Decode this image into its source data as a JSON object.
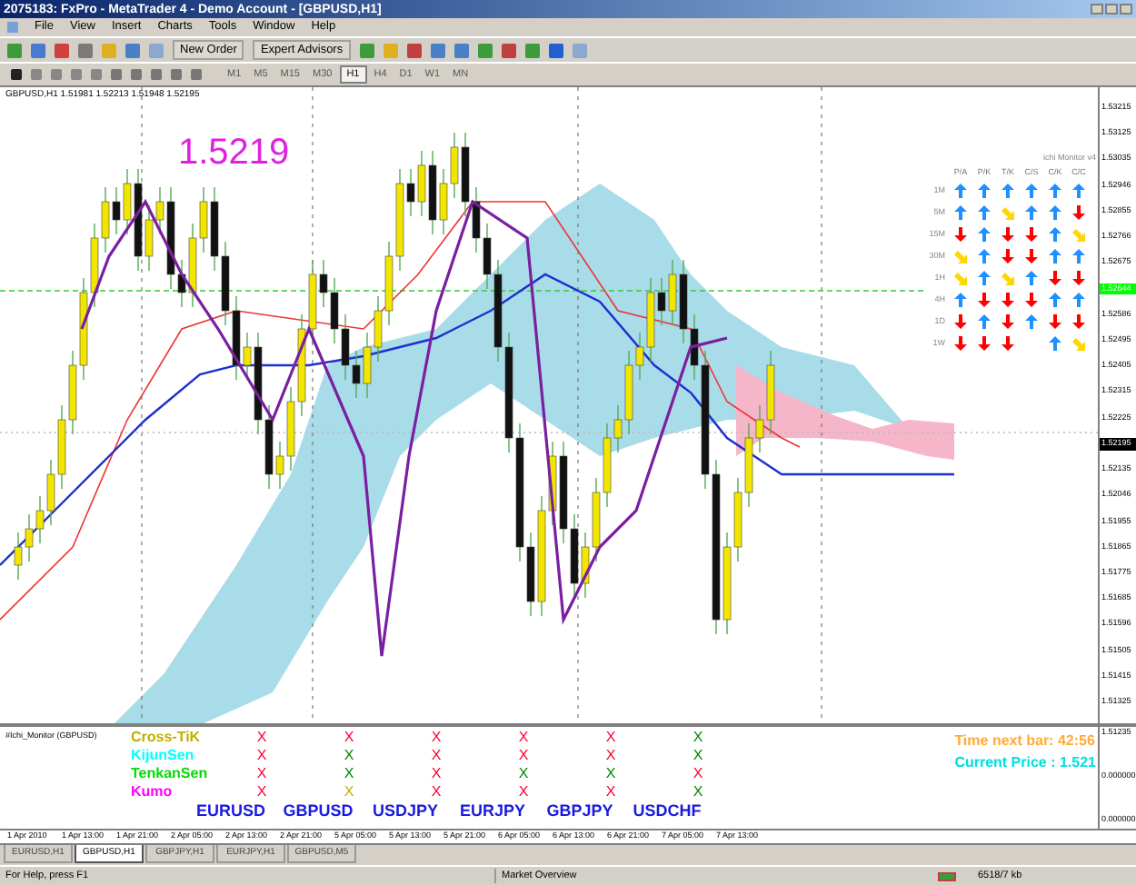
{
  "window": {
    "title": "2075183: FxPro - MetaTrader 4 - Demo Account - [GBPUSD,H1]"
  },
  "menu": [
    "File",
    "View",
    "Insert",
    "Charts",
    "Tools",
    "Window",
    "Help"
  ],
  "toolbar": {
    "buttons": [
      "New Order",
      "Expert Advisors"
    ]
  },
  "timeframes": [
    {
      "label": "M1",
      "selected": false
    },
    {
      "label": "M5",
      "selected": false
    },
    {
      "label": "M15",
      "selected": false
    },
    {
      "label": "M30",
      "selected": false
    },
    {
      "label": "H1",
      "selected": true
    },
    {
      "label": "H4",
      "selected": false
    },
    {
      "label": "D1",
      "selected": false
    },
    {
      "label": "W1",
      "selected": false
    },
    {
      "label": "MN",
      "selected": false
    }
  ],
  "chart": {
    "header": "GBPUSD,H1  1.51981 1.52213 1.51948 1.52195",
    "price_label": "1.5219",
    "price_axis": [
      {
        "label": "1.53215",
        "kind": "tick"
      },
      {
        "label": "1.53125",
        "kind": "tick"
      },
      {
        "label": "1.53035",
        "kind": "tick"
      },
      {
        "label": "1.52946",
        "kind": "tick"
      },
      {
        "label": "1.52855",
        "kind": "tick"
      },
      {
        "label": "1.52766",
        "kind": "tick"
      },
      {
        "label": "1.52675",
        "kind": "tick"
      },
      {
        "label": "1.52644",
        "kind": "marker",
        "color": "#00ff00"
      },
      {
        "label": "1.52586",
        "kind": "tick"
      },
      {
        "label": "1.52495",
        "kind": "tick"
      },
      {
        "label": "1.52405",
        "kind": "tick"
      },
      {
        "label": "1.52315",
        "kind": "tick"
      },
      {
        "label": "1.52225",
        "kind": "tick"
      },
      {
        "label": "1.52195",
        "kind": "marker",
        "color": "#000000"
      },
      {
        "label": "1.52135",
        "kind": "tick"
      },
      {
        "label": "1.52046",
        "kind": "tick"
      },
      {
        "label": "1.51955",
        "kind": "tick"
      },
      {
        "label": "1.51865",
        "kind": "tick"
      },
      {
        "label": "1.51775",
        "kind": "tick"
      },
      {
        "label": "1.51685",
        "kind": "tick"
      },
      {
        "label": "1.51596",
        "kind": "tick"
      },
      {
        "label": "1.51505",
        "kind": "tick"
      },
      {
        "label": "1.51415",
        "kind": "tick"
      },
      {
        "label": "1.51325",
        "kind": "tick"
      }
    ]
  },
  "monitor": {
    "title": "ichi Monitor v4",
    "columns": [
      "P/A",
      "P/K",
      "T/K",
      "C/S",
      "C/K",
      "C/C"
    ],
    "rows": [
      {
        "label": "1M",
        "cells": [
          {
            "kind": "up",
            "color": "#1e90ff"
          },
          {
            "kind": "up",
            "color": "#1e90ff"
          },
          {
            "kind": "up",
            "color": "#1e90ff"
          },
          {
            "kind": "up",
            "color": "#1e90ff"
          },
          {
            "kind": "up",
            "color": "#1e90ff"
          },
          {
            "kind": "up",
            "color": "#1e90ff"
          }
        ]
      },
      {
        "label": "5M",
        "cells": [
          {
            "kind": "up",
            "color": "#1e90ff"
          },
          {
            "kind": "up",
            "color": "#1e90ff"
          },
          {
            "kind": "side",
            "color": "#ffd700"
          },
          {
            "kind": "up",
            "color": "#1e90ff"
          },
          {
            "kind": "up",
            "color": "#1e90ff"
          },
          {
            "kind": "down",
            "color": "#ff0000"
          }
        ]
      },
      {
        "label": "15M",
        "cells": [
          {
            "kind": "down",
            "color": "#ff0000"
          },
          {
            "kind": "up",
            "color": "#1e90ff"
          },
          {
            "kind": "down",
            "color": "#ff0000"
          },
          {
            "kind": "down",
            "color": "#ff0000"
          },
          {
            "kind": "up",
            "color": "#1e90ff"
          },
          {
            "kind": "side",
            "color": "#ffd700"
          }
        ]
      },
      {
        "label": "30M",
        "cells": [
          {
            "kind": "side",
            "color": "#ffd700"
          },
          {
            "kind": "up",
            "color": "#1e90ff"
          },
          {
            "kind": "down",
            "color": "#ff0000"
          },
          {
            "kind": "down",
            "color": "#ff0000"
          },
          {
            "kind": "up",
            "color": "#1e90ff"
          },
          {
            "kind": "up",
            "color": "#1e90ff"
          }
        ]
      },
      {
        "label": "1H",
        "cells": [
          {
            "kind": "side",
            "color": "#ffd700"
          },
          {
            "kind": "up",
            "color": "#1e90ff"
          },
          {
            "kind": "side",
            "color": "#ffd700"
          },
          {
            "kind": "up",
            "color": "#1e90ff"
          },
          {
            "kind": "down",
            "color": "#ff0000"
          },
          {
            "kind": "down",
            "color": "#ff0000"
          }
        ]
      },
      {
        "label": "4H",
        "cells": [
          {
            "kind": "up",
            "color": "#1e90ff"
          },
          {
            "kind": "down",
            "color": "#ff0000"
          },
          {
            "kind": "down",
            "color": "#ff0000"
          },
          {
            "kind": "down",
            "color": "#ff0000"
          },
          {
            "kind": "up",
            "color": "#1e90ff"
          },
          {
            "kind": "up",
            "color": "#1e90ff"
          }
        ]
      },
      {
        "label": "1D",
        "cells": [
          {
            "kind": "down",
            "color": "#ff0000"
          },
          {
            "kind": "up",
            "color": "#1e90ff"
          },
          {
            "kind": "down",
            "color": "#ff0000"
          },
          {
            "kind": "up",
            "color": "#1e90ff"
          },
          {
            "kind": "down",
            "color": "#ff0000"
          },
          {
            "kind": "down",
            "color": "#ff0000"
          }
        ]
      },
      {
        "label": "1W",
        "cells": [
          {
            "kind": "down",
            "color": "#ff0000"
          },
          {
            "kind": "down",
            "color": "#ff0000"
          },
          {
            "kind": "down",
            "color": "#ff0000"
          },
          {
            "kind": "none"
          },
          {
            "kind": "up",
            "color": "#1e90ff"
          },
          {
            "kind": "side",
            "color": "#ffd700"
          }
        ]
      }
    ]
  },
  "indicator": {
    "title": "#Ichi_Monitor (GBPUSD)",
    "signals": [
      {
        "label": "Cross-TiK",
        "color": "#c0b000"
      },
      {
        "label": "KijunSen",
        "color": "#00ffff"
      },
      {
        "label": "TenkanSen",
        "color": "#00dd00"
      },
      {
        "label": "Kumo",
        "color": "#ff00ff"
      }
    ],
    "pairs": [
      {
        "name": "EURUSD",
        "marks": [
          {
            "text": "X",
            "color": "#ff0033"
          },
          {
            "text": "X",
            "color": "#ff0033"
          },
          {
            "text": "X",
            "color": "#ff0033"
          },
          {
            "text": "X",
            "color": "#ff0033"
          }
        ]
      },
      {
        "name": "GBPUSD",
        "marks": [
          {
            "text": "X",
            "color": "#ff0033"
          },
          {
            "text": "X",
            "color": "#008800"
          },
          {
            "text": "X",
            "color": "#008800"
          },
          {
            "text": "X",
            "color": "#c0b000"
          }
        ]
      },
      {
        "name": "USDJPY",
        "marks": [
          {
            "text": "X",
            "color": "#ff0033"
          },
          {
            "text": "X",
            "color": "#ff0033"
          },
          {
            "text": "X",
            "color": "#ff0033"
          },
          {
            "text": "X",
            "color": "#ff0033"
          }
        ]
      },
      {
        "name": "EURJPY",
        "marks": [
          {
            "text": "X",
            "color": "#ff0033"
          },
          {
            "text": "X",
            "color": "#ff0033"
          },
          {
            "text": "X",
            "color": "#008800"
          },
          {
            "text": "X",
            "color": "#ff0033"
          }
        ]
      },
      {
        "name": "GBPJPY",
        "marks": [
          {
            "text": "X",
            "color": "#ff0033"
          },
          {
            "text": "X",
            "color": "#ff0033"
          },
          {
            "text": "X",
            "color": "#008800"
          },
          {
            "text": "X",
            "color": "#ff0033"
          }
        ]
      },
      {
        "name": "USDCHF",
        "marks": [
          {
            "text": "X",
            "color": "#008800"
          },
          {
            "text": "X",
            "color": "#008800"
          },
          {
            "text": "X",
            "color": "#ff0033"
          },
          {
            "text": "X",
            "color": "#008800"
          }
        ]
      }
    ],
    "time_next_bar": "Time next bar:  42:56",
    "current_price": "Current Price :  1.521",
    "axis": [
      "1.51235",
      "0.000000",
      "0.000000"
    ]
  },
  "time_axis": [
    "1 Apr 2010",
    "1 Apr 13:00",
    "1 Apr 21:00",
    "2 Apr 05:00",
    "2 Apr 13:00",
    "2 Apr 21:00",
    "5 Apr 05:00",
    "5 Apr 13:00",
    "5 Apr 21:00",
    "6 Apr 05:00",
    "6 Apr 13:00",
    "6 Apr 21:00",
    "7 Apr 05:00",
    "7 Apr 13:00"
  ],
  "tabs": [
    {
      "label": "EURUSD,H1",
      "selected": false
    },
    {
      "label": "GBPUSD,H1",
      "selected": true
    },
    {
      "label": "GBPJPY,H1",
      "selected": false
    },
    {
      "label": "EURJPY,H1",
      "selected": false
    },
    {
      "label": "GBPUSD,M5",
      "selected": false
    }
  ],
  "status_bar": {
    "help": "For Help, press F1",
    "profile": "Market Overview",
    "memory": "6518/7 kb"
  }
}
